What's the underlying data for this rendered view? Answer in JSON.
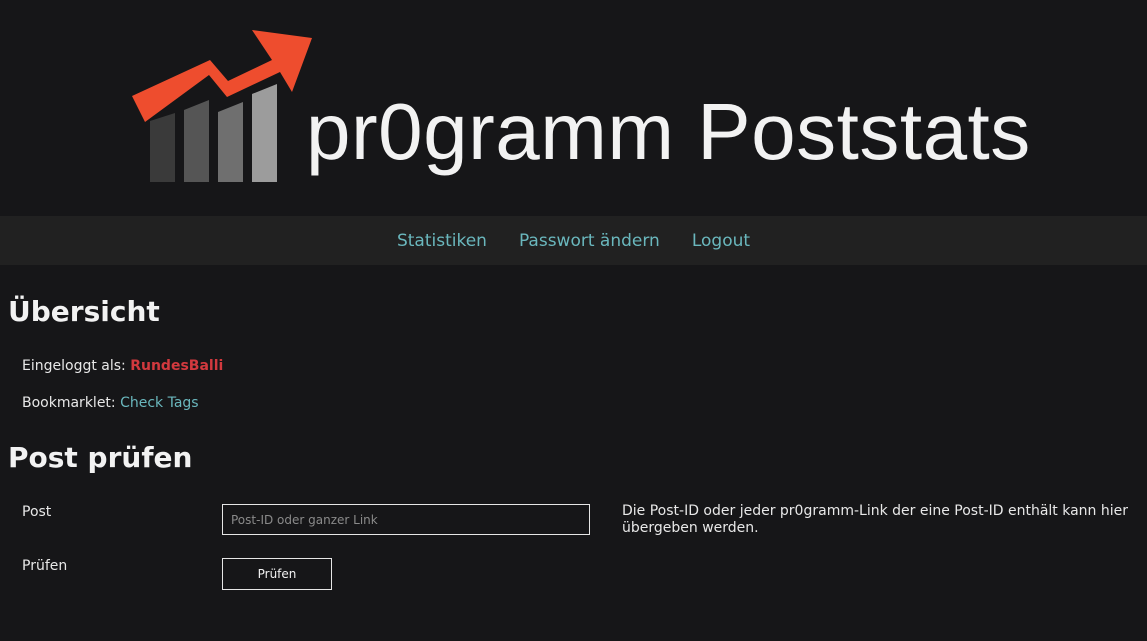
{
  "header": {
    "logo_text": "pr0gramm Poststats"
  },
  "nav": [
    {
      "label": "Statistiken"
    },
    {
      "label": "Passwort ändern"
    },
    {
      "label": "Logout"
    }
  ],
  "overview": {
    "title": "Übersicht",
    "logged_in_label": "Eingeloggt als:",
    "username": "RundesBalli",
    "bookmarklet_label": "Bookmarklet:",
    "bookmarklet_link": "Check Tags"
  },
  "check": {
    "title": "Post prüfen",
    "post_label": "Post",
    "post_placeholder": "Post-ID oder ganzer Link",
    "submit_label": "Prüfen",
    "button_label": "Prüfen",
    "hint": "Die Post-ID oder jeder pr0gramm-Link der eine Post-ID enthält kann hier übergeben werden."
  },
  "colors": {
    "background": "#161618",
    "nav_background": "#212121",
    "link": "#6ab7bd",
    "username": "#d2393e",
    "logo_arrow": "#ee4d2e"
  },
  "icons": {
    "logo": "rising-bar-chart-arrow-icon"
  }
}
